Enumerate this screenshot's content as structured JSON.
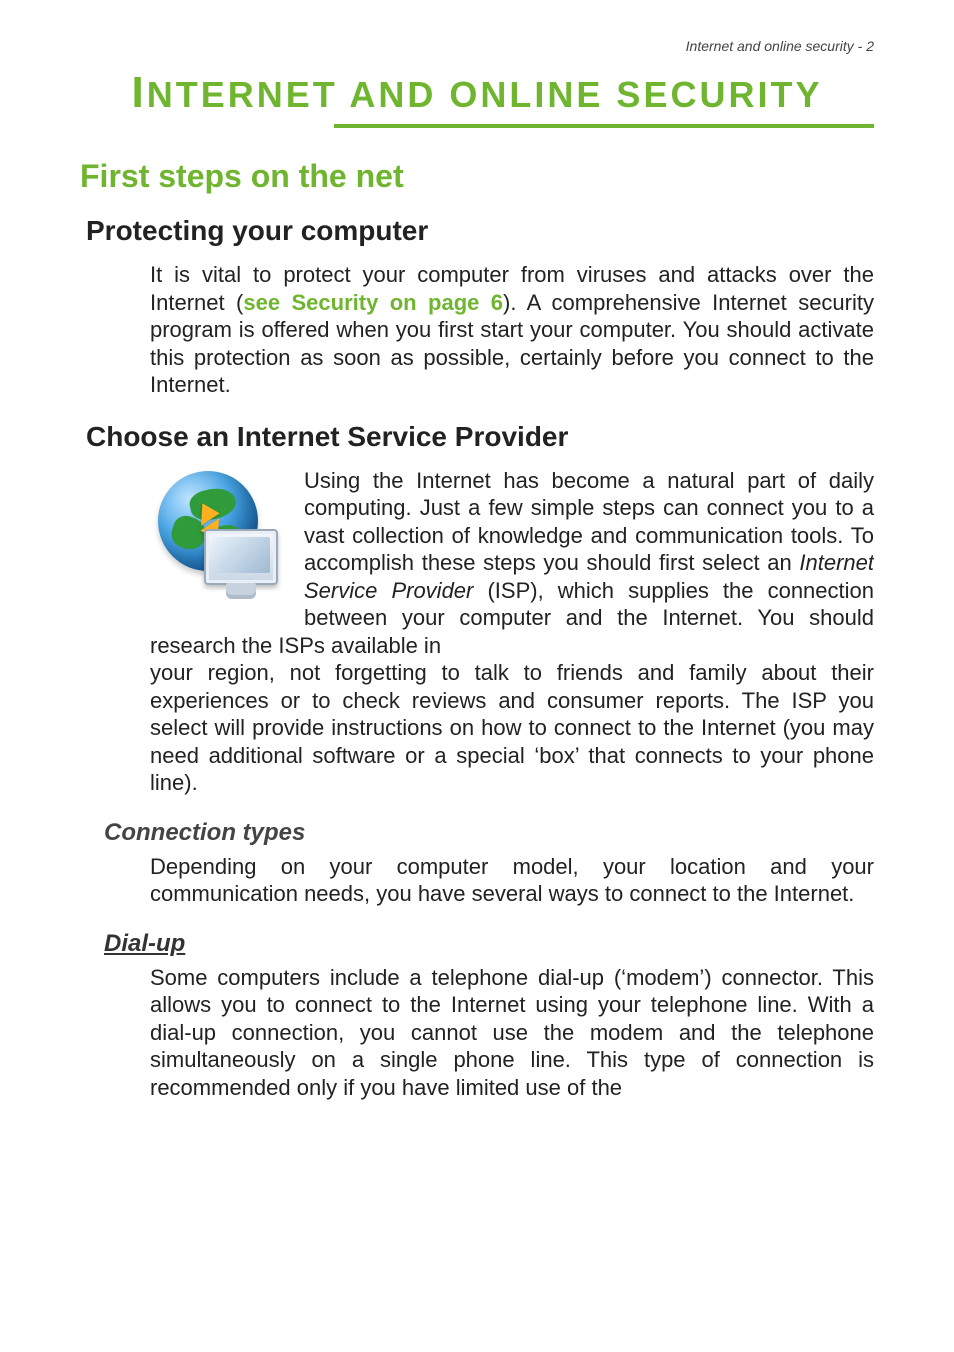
{
  "header": {
    "running": "Internet and online security - 2"
  },
  "title": {
    "first": "I",
    "rest": "NTERNET AND ONLINE SECURITY"
  },
  "h1": "First steps on the net",
  "protect": {
    "heading": "Protecting your computer",
    "p_before": "It is vital to protect your computer from viruses and attacks over the Internet (",
    "link": "see Security on page 6",
    "p_after": "). A comprehensive Internet security program is offered when you first start your computer. You should activate this protection as soon as possible, certainly before you connect to the Internet."
  },
  "isp": {
    "heading": "Choose an Internet Service Provider",
    "p_a": "Using the Internet has become a natural part of daily computing. Just a few simple steps can connect you to a vast collection of knowledge and communication tools. To accomplish these steps you should first select an ",
    "term": "Internet Service Provider",
    "p_b": " (ISP), which supplies the connection between your computer and the Internet. You should research the ISPs available in ",
    "p_c": "your region, not forgetting to talk to friends and family about their experiences or to check reviews and consumer reports. The ISP you select will provide instructions on how to connect to the Internet (you may need additional software or a special ‘box’ that connects to your phone line)."
  },
  "conn": {
    "heading": "Connection types",
    "p": "Depending on your computer model, your location and your communication needs, you have several ways to connect to the Internet."
  },
  "dialup": {
    "heading": "Dial-up",
    "p": "Some computers include a telephone dial-up (‘modem’) connector. This allows you to connect to the Internet using your telephone line. With a dial-up connection, you cannot use the modem and the telephone simultaneously on a single phone line. This type of connection is recommended only if you have limited use of the"
  },
  "icon": {
    "name": "globe-monitor-internet-icon"
  }
}
